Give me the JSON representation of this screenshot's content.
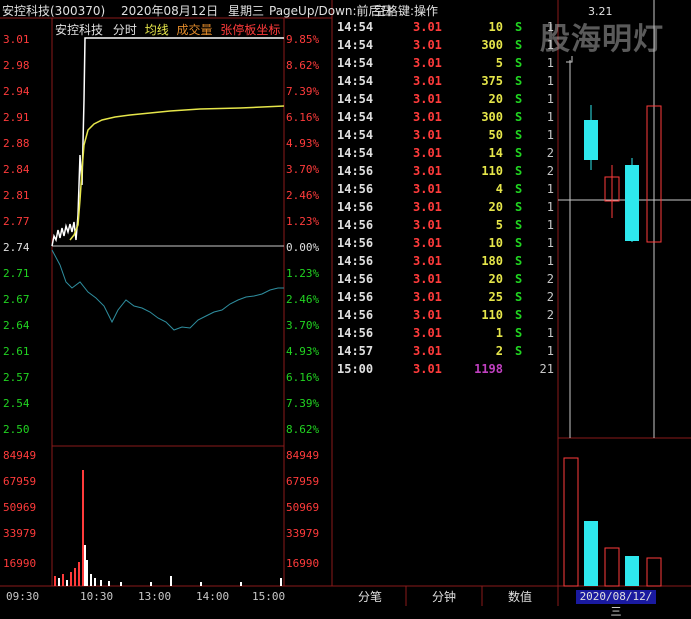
{
  "header": {
    "stock": "安控科技(300370)",
    "date": "2020年08月12日",
    "weekday": "星期三",
    "hint": "PageUp/Down:前后日",
    "hint2": "空格键:操作"
  },
  "legend": {
    "name": "安控科技",
    "minute": "分时",
    "avg": "均线",
    "volume": "成交量",
    "limit": "张停板坐标"
  },
  "price_axis": {
    "left": [
      "3.01",
      "2.98",
      "2.94",
      "2.91",
      "2.88",
      "2.84",
      "2.81",
      "2.77",
      "2.74",
      "2.71",
      "2.67",
      "2.64",
      "2.61",
      "2.57",
      "2.54",
      "2.50"
    ],
    "right": [
      "9.85%",
      "8.62%",
      "7.39%",
      "6.16%",
      "4.93%",
      "3.70%",
      "2.46%",
      "1.23%",
      "0.00%",
      "1.23%",
      "2.46%",
      "3.70%",
      "4.93%",
      "6.16%",
      "7.39%",
      "8.62%"
    ]
  },
  "volume_axis": {
    "left": [
      "84949",
      "67959",
      "50969",
      "33979",
      "16990"
    ],
    "right": [
      "84949",
      "67959",
      "50969",
      "33979",
      "16990"
    ]
  },
  "time_axis": [
    "09:30",
    "10:30",
    "13:00",
    "14:00",
    "15:00"
  ],
  "trades": [
    {
      "time": "14:54",
      "price": "3.01",
      "vol": "10",
      "bs": "S",
      "cnt": "1"
    },
    {
      "time": "14:54",
      "price": "3.01",
      "vol": "300",
      "bs": "S",
      "cnt": "1"
    },
    {
      "time": "14:54",
      "price": "3.01",
      "vol": "5",
      "bs": "S",
      "cnt": "1"
    },
    {
      "time": "14:54",
      "price": "3.01",
      "vol": "375",
      "bs": "S",
      "cnt": "1"
    },
    {
      "time": "14:54",
      "price": "3.01",
      "vol": "20",
      "bs": "S",
      "cnt": "1"
    },
    {
      "time": "14:54",
      "price": "3.01",
      "vol": "300",
      "bs": "S",
      "cnt": "1"
    },
    {
      "time": "14:54",
      "price": "3.01",
      "vol": "50",
      "bs": "S",
      "cnt": "1"
    },
    {
      "time": "14:54",
      "price": "3.01",
      "vol": "14",
      "bs": "S",
      "cnt": "2"
    },
    {
      "time": "14:56",
      "price": "3.01",
      "vol": "110",
      "bs": "S",
      "cnt": "2"
    },
    {
      "time": "14:56",
      "price": "3.01",
      "vol": "4",
      "bs": "S",
      "cnt": "1"
    },
    {
      "time": "14:56",
      "price": "3.01",
      "vol": "20",
      "bs": "S",
      "cnt": "1"
    },
    {
      "time": "14:56",
      "price": "3.01",
      "vol": "5",
      "bs": "S",
      "cnt": "1"
    },
    {
      "time": "14:56",
      "price": "3.01",
      "vol": "10",
      "bs": "S",
      "cnt": "1"
    },
    {
      "time": "14:56",
      "price": "3.01",
      "vol": "180",
      "bs": "S",
      "cnt": "1"
    },
    {
      "time": "14:56",
      "price": "3.01",
      "vol": "20",
      "bs": "S",
      "cnt": "2"
    },
    {
      "time": "14:56",
      "price": "3.01",
      "vol": "25",
      "bs": "S",
      "cnt": "2"
    },
    {
      "time": "14:56",
      "price": "3.01",
      "vol": "110",
      "bs": "S",
      "cnt": "2"
    },
    {
      "time": "14:56",
      "price": "3.01",
      "vol": "1",
      "bs": "S",
      "cnt": "1"
    },
    {
      "time": "14:57",
      "price": "3.01",
      "vol": "2",
      "bs": "S",
      "cnt": "1"
    },
    {
      "time": "15:00",
      "price": "3.01",
      "vol": "1198",
      "bs": "",
      "cnt": "21"
    }
  ],
  "tabs": [
    "分笔",
    "分钟",
    "数值"
  ],
  "kline": {
    "price_label": "3.21",
    "date": "2020/08/12/三"
  },
  "watermark": "股海明灯",
  "colors": {
    "up": "#ff3b3b",
    "down": "#21d421",
    "price_line": "#ffffff",
    "avg_line": "#e6e64a",
    "cyan": "#2ee8ee"
  }
}
